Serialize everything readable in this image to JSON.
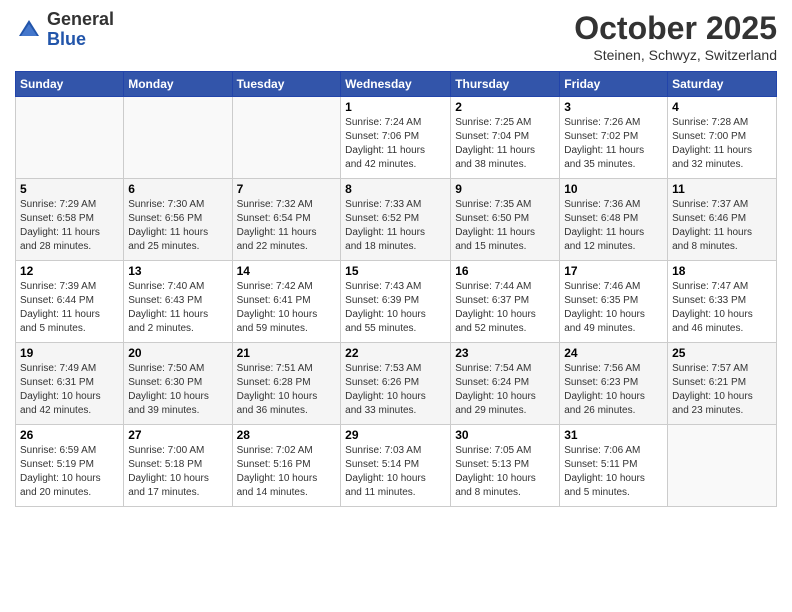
{
  "header": {
    "logo_general": "General",
    "logo_blue": "Blue",
    "month_title": "October 2025",
    "location": "Steinen, Schwyz, Switzerland"
  },
  "days_of_week": [
    "Sunday",
    "Monday",
    "Tuesday",
    "Wednesday",
    "Thursday",
    "Friday",
    "Saturday"
  ],
  "weeks": [
    [
      {
        "day": "",
        "info": ""
      },
      {
        "day": "",
        "info": ""
      },
      {
        "day": "",
        "info": ""
      },
      {
        "day": "1",
        "info": "Sunrise: 7:24 AM\nSunset: 7:06 PM\nDaylight: 11 hours\nand 42 minutes."
      },
      {
        "day": "2",
        "info": "Sunrise: 7:25 AM\nSunset: 7:04 PM\nDaylight: 11 hours\nand 38 minutes."
      },
      {
        "day": "3",
        "info": "Sunrise: 7:26 AM\nSunset: 7:02 PM\nDaylight: 11 hours\nand 35 minutes."
      },
      {
        "day": "4",
        "info": "Sunrise: 7:28 AM\nSunset: 7:00 PM\nDaylight: 11 hours\nand 32 minutes."
      }
    ],
    [
      {
        "day": "5",
        "info": "Sunrise: 7:29 AM\nSunset: 6:58 PM\nDaylight: 11 hours\nand 28 minutes."
      },
      {
        "day": "6",
        "info": "Sunrise: 7:30 AM\nSunset: 6:56 PM\nDaylight: 11 hours\nand 25 minutes."
      },
      {
        "day": "7",
        "info": "Sunrise: 7:32 AM\nSunset: 6:54 PM\nDaylight: 11 hours\nand 22 minutes."
      },
      {
        "day": "8",
        "info": "Sunrise: 7:33 AM\nSunset: 6:52 PM\nDaylight: 11 hours\nand 18 minutes."
      },
      {
        "day": "9",
        "info": "Sunrise: 7:35 AM\nSunset: 6:50 PM\nDaylight: 11 hours\nand 15 minutes."
      },
      {
        "day": "10",
        "info": "Sunrise: 7:36 AM\nSunset: 6:48 PM\nDaylight: 11 hours\nand 12 minutes."
      },
      {
        "day": "11",
        "info": "Sunrise: 7:37 AM\nSunset: 6:46 PM\nDaylight: 11 hours\nand 8 minutes."
      }
    ],
    [
      {
        "day": "12",
        "info": "Sunrise: 7:39 AM\nSunset: 6:44 PM\nDaylight: 11 hours\nand 5 minutes."
      },
      {
        "day": "13",
        "info": "Sunrise: 7:40 AM\nSunset: 6:43 PM\nDaylight: 11 hours\nand 2 minutes."
      },
      {
        "day": "14",
        "info": "Sunrise: 7:42 AM\nSunset: 6:41 PM\nDaylight: 10 hours\nand 59 minutes."
      },
      {
        "day": "15",
        "info": "Sunrise: 7:43 AM\nSunset: 6:39 PM\nDaylight: 10 hours\nand 55 minutes."
      },
      {
        "day": "16",
        "info": "Sunrise: 7:44 AM\nSunset: 6:37 PM\nDaylight: 10 hours\nand 52 minutes."
      },
      {
        "day": "17",
        "info": "Sunrise: 7:46 AM\nSunset: 6:35 PM\nDaylight: 10 hours\nand 49 minutes."
      },
      {
        "day": "18",
        "info": "Sunrise: 7:47 AM\nSunset: 6:33 PM\nDaylight: 10 hours\nand 46 minutes."
      }
    ],
    [
      {
        "day": "19",
        "info": "Sunrise: 7:49 AM\nSunset: 6:31 PM\nDaylight: 10 hours\nand 42 minutes."
      },
      {
        "day": "20",
        "info": "Sunrise: 7:50 AM\nSunset: 6:30 PM\nDaylight: 10 hours\nand 39 minutes."
      },
      {
        "day": "21",
        "info": "Sunrise: 7:51 AM\nSunset: 6:28 PM\nDaylight: 10 hours\nand 36 minutes."
      },
      {
        "day": "22",
        "info": "Sunrise: 7:53 AM\nSunset: 6:26 PM\nDaylight: 10 hours\nand 33 minutes."
      },
      {
        "day": "23",
        "info": "Sunrise: 7:54 AM\nSunset: 6:24 PM\nDaylight: 10 hours\nand 29 minutes."
      },
      {
        "day": "24",
        "info": "Sunrise: 7:56 AM\nSunset: 6:23 PM\nDaylight: 10 hours\nand 26 minutes."
      },
      {
        "day": "25",
        "info": "Sunrise: 7:57 AM\nSunset: 6:21 PM\nDaylight: 10 hours\nand 23 minutes."
      }
    ],
    [
      {
        "day": "26",
        "info": "Sunrise: 6:59 AM\nSunset: 5:19 PM\nDaylight: 10 hours\nand 20 minutes."
      },
      {
        "day": "27",
        "info": "Sunrise: 7:00 AM\nSunset: 5:18 PM\nDaylight: 10 hours\nand 17 minutes."
      },
      {
        "day": "28",
        "info": "Sunrise: 7:02 AM\nSunset: 5:16 PM\nDaylight: 10 hours\nand 14 minutes."
      },
      {
        "day": "29",
        "info": "Sunrise: 7:03 AM\nSunset: 5:14 PM\nDaylight: 10 hours\nand 11 minutes."
      },
      {
        "day": "30",
        "info": "Sunrise: 7:05 AM\nSunset: 5:13 PM\nDaylight: 10 hours\nand 8 minutes."
      },
      {
        "day": "31",
        "info": "Sunrise: 7:06 AM\nSunset: 5:11 PM\nDaylight: 10 hours\nand 5 minutes."
      },
      {
        "day": "",
        "info": ""
      }
    ]
  ]
}
